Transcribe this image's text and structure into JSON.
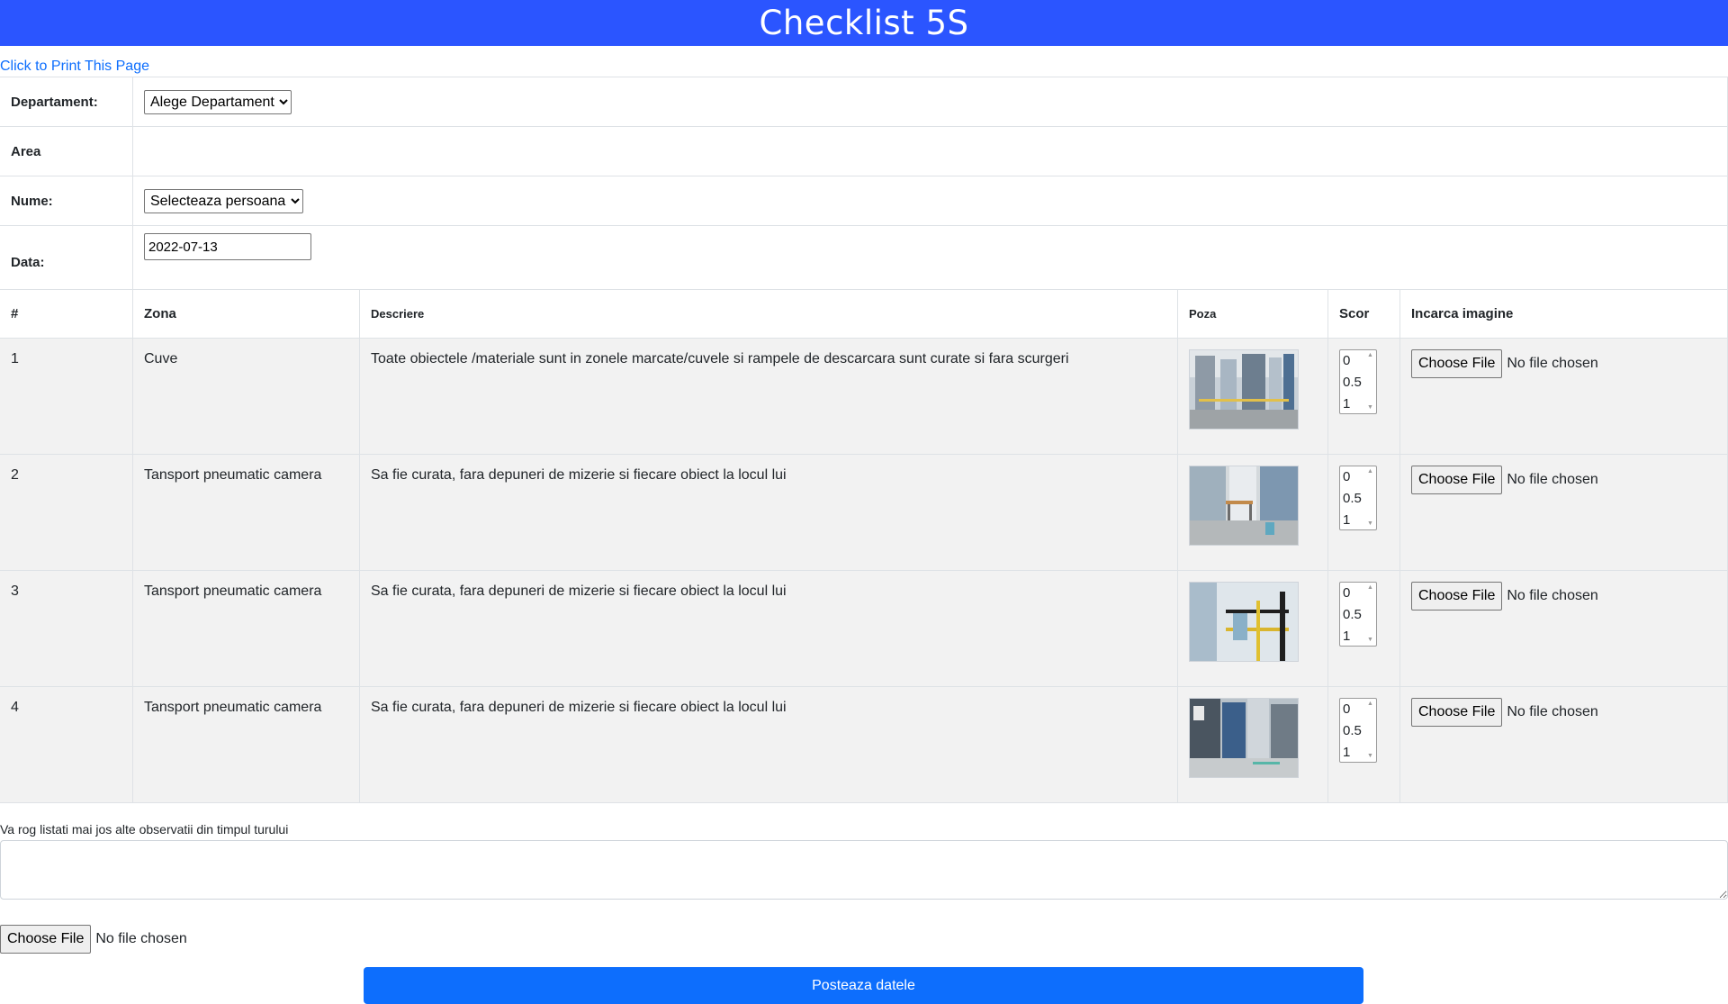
{
  "header": {
    "title": "Checklist 5S",
    "color": "#2b55ff"
  },
  "print_link": "Click to Print This Page",
  "meta": {
    "departament_label": "Departament:",
    "departament_value": "Alege Departament",
    "area_label": "Area",
    "nume_label": "Nume:",
    "nume_value": "Selecteaza persoana",
    "data_label": "Data:",
    "data_value": "2022-07-13"
  },
  "table": {
    "headers": {
      "num": "#",
      "zona": "Zona",
      "descriere": "Descriere",
      "poza": "Poza",
      "scor": "Scor",
      "incarca": "Incarca imagine"
    },
    "rows": [
      {
        "num": "1",
        "zona": "Cuve",
        "descriere": "Toate obiectele /materiale sunt in zonele marcate/cuvele si rampele de descarcara sunt curate si fara scurgeri"
      },
      {
        "num": "2",
        "zona": "Tansport pneumatic camera",
        "descriere": "Sa fie curata, fara depuneri de mizerie si fiecare obiect la locul lui"
      },
      {
        "num": "3",
        "zona": "Tansport pneumatic camera",
        "descriere": "Sa fie curata, fara depuneri de mizerie si fiecare obiect la locul lui"
      },
      {
        "num": "4",
        "zona": "Tansport pneumatic camera",
        "descriere": "Sa fie curata, fara depuneri de mizerie si fiecare obiect la locul lui"
      }
    ],
    "score_options": [
      "0",
      "0.5",
      "1"
    ]
  },
  "file_input": {
    "button": "Choose File",
    "status": "No file chosen"
  },
  "observations_label": "Va rog listati mai jos alte observatii din timpul turului",
  "submit_label": "Posteaza datele",
  "submit_color": "#0d6efd"
}
